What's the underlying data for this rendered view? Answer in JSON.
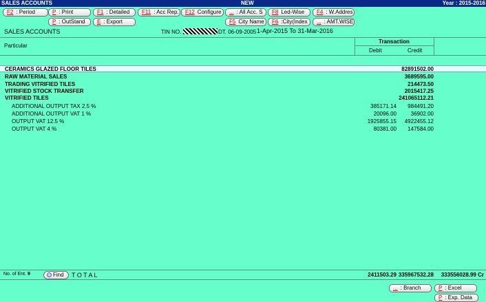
{
  "titlebar": {
    "left": "SALES ACCOUNTS",
    "center": "NEW",
    "right": "Year : 2015-2016"
  },
  "toolbar_row1": [
    {
      "key": "F2",
      "label": ": Period"
    },
    {
      "key": "P",
      "label": ": Print"
    },
    {
      "key": "F1",
      "label": ": Detailed"
    },
    {
      "key": "F11",
      "label": ": Acc Rep."
    },
    {
      "key": "F12",
      "label": "Configure"
    },
    {
      "key": "...",
      "label": ": All Acc. S"
    },
    {
      "key": "F8",
      "label": "Led-Wise"
    },
    {
      "key": "F4",
      "label": ": W.Addres"
    }
  ],
  "toolbar_row2": [
    {
      "key": "P",
      "label": ": OutStand"
    },
    {
      "key": "E",
      "label": ": Export"
    },
    {
      "key": "F5",
      "label": "City Name"
    },
    {
      "key": "F6",
      "label": ":City(Index"
    },
    {
      "key": "...",
      "label": ": AMT.WISE"
    }
  ],
  "report": {
    "title": "SALES ACCOUNTS",
    "tin_label": "TIN NO.",
    "date_label": "DT. 06-09-2005",
    "period": "1-Apr-2015 To 31-Mar-2016"
  },
  "table": {
    "col_particular": "Particular",
    "col_transaction": "Transaction",
    "col_debit": "Debit",
    "col_credit": "Credit",
    "rows": [
      {
        "name": "CERAMICS GLAZED FLOOR TILES",
        "debit": "",
        "credit": "82891502.00",
        "bold": true,
        "indent": false
      },
      {
        "name": "RAW MATERIAL SALES",
        "debit": "",
        "credit": "3689595.00",
        "bold": true,
        "indent": false
      },
      {
        "name": "TRADING VITRIFIED TILES",
        "debit": "",
        "credit": "214473.50",
        "bold": true,
        "indent": false
      },
      {
        "name": "VITRIFIED STOCK TRANSFER",
        "debit": "",
        "credit": "2015417.25",
        "bold": true,
        "indent": false
      },
      {
        "name": "VITRIFIED TILES",
        "debit": "",
        "credit": "241065112.21",
        "bold": true,
        "indent": false
      },
      {
        "name": "ADDITIONAL OUTPUT TAX 2.5 %",
        "debit": "385171.14",
        "credit": "984491.20",
        "bold": false,
        "indent": true
      },
      {
        "name": "ADDITIONAL OUTPUT VAT 1 %",
        "debit": "20096.00",
        "credit": "36902.00",
        "bold": false,
        "indent": true
      },
      {
        "name": "OUTPUT VAT 12.5 %",
        "debit": "1925855.15",
        "credit": "4922455.12",
        "bold": false,
        "indent": true
      },
      {
        "name": "OUTPUT VAT 4 %",
        "debit": "80381.00",
        "credit": "147584.00",
        "bold": false,
        "indent": true
      }
    ]
  },
  "footer": {
    "entries_label": "No. of Ent.",
    "entries_count": "9",
    "find_label": "Find",
    "total_label": "T O T A L",
    "total_debit": "2411503.29",
    "total_credit": "335967532.28",
    "total_balance": "333556028.99 Cr"
  },
  "bottom_buttons": {
    "branch": {
      "key": "...",
      "label": ": Branch"
    },
    "excel": {
      "key": "P",
      "label": ": Excel"
    },
    "expdata": {
      "key": "P",
      "label": ": Exp. Data"
    }
  }
}
